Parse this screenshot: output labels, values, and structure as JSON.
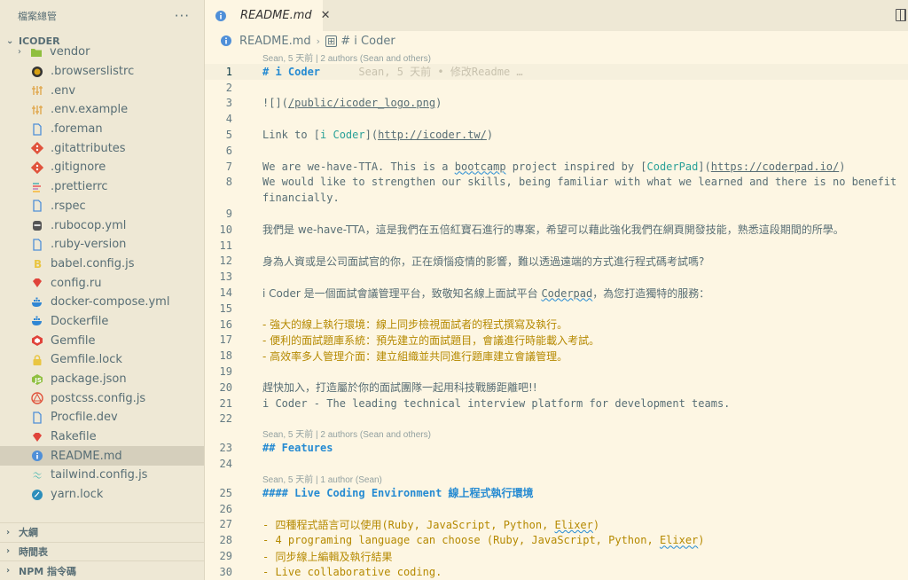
{
  "sidebar": {
    "title": "檔案總管",
    "more": "···",
    "project": "ICODER",
    "files": [
      {
        "name": "vendor",
        "icon": "folder-icon",
        "color": "#8fbf3f",
        "folder": true
      },
      {
        "name": ".browserslistrc",
        "icon": "browserslist-icon",
        "color": "#d6a013"
      },
      {
        "name": ".env",
        "icon": "env-icon",
        "color": "#e0a84e"
      },
      {
        "name": ".env.example",
        "icon": "env-icon",
        "color": "#e0a84e"
      },
      {
        "name": ".foreman",
        "icon": "file-icon",
        "color": "#4f8fd8"
      },
      {
        "name": ".gitattributes",
        "icon": "git-icon",
        "color": "#e0533c"
      },
      {
        "name": ".gitignore",
        "icon": "git-icon",
        "color": "#e0533c"
      },
      {
        "name": ".prettierrc",
        "icon": "prettier-icon",
        "color": "#c69bd6"
      },
      {
        "name": ".rspec",
        "icon": "file-icon",
        "color": "#4f8fd8"
      },
      {
        "name": ".rubocop.yml",
        "icon": "rubocop-icon",
        "color": "#555555"
      },
      {
        "name": ".ruby-version",
        "icon": "file-icon",
        "color": "#4f8fd8"
      },
      {
        "name": "babel.config.js",
        "icon": "babel-icon",
        "color": "#e9c541"
      },
      {
        "name": "config.ru",
        "icon": "ruby-icon",
        "color": "#e0433a"
      },
      {
        "name": "docker-compose.yml",
        "icon": "docker-icon",
        "color": "#2f86d4"
      },
      {
        "name": "Dockerfile",
        "icon": "docker-icon",
        "color": "#2f86d4"
      },
      {
        "name": "Gemfile",
        "icon": "gem-icon",
        "color": "#e0433a"
      },
      {
        "name": "Gemfile.lock",
        "icon": "lock-icon",
        "color": "#e9c541"
      },
      {
        "name": "package.json",
        "icon": "npm-icon",
        "color": "#8fbf3f"
      },
      {
        "name": "postcss.config.js",
        "icon": "postcss-icon",
        "color": "#e0533c"
      },
      {
        "name": "Procfile.dev",
        "icon": "file-icon",
        "color": "#4f8fd8"
      },
      {
        "name": "Rakefile",
        "icon": "ruby-icon",
        "color": "#e0433a"
      },
      {
        "name": "README.md",
        "icon": "info-icon",
        "color": "#4f8fd8",
        "active": true
      },
      {
        "name": "tailwind.config.js",
        "icon": "tailwind-icon",
        "color": "#38b2ac"
      },
      {
        "name": "yarn.lock",
        "icon": "yarn-icon",
        "color": "#2c8ebb"
      }
    ],
    "panels": [
      "大綱",
      "時間表",
      "NPM 指令碼"
    ]
  },
  "tab": {
    "title": "README.md",
    "close": "✕"
  },
  "breadcrumb": {
    "file": "README.md",
    "sep": "›",
    "section": "# i Coder"
  },
  "editor": {
    "lines": [
      {
        "type": "lens",
        "text": "Sean, 5 天前 | 2 authors (Sean and others)"
      },
      {
        "n": "1",
        "segs": [
          {
            "c": "hdr",
            "t": "# i Coder"
          },
          {
            "c": "blame",
            "t": "      Sean, 5 天前 • 修改Readme …"
          }
        ],
        "current": true
      },
      {
        "n": "2",
        "segs": []
      },
      {
        "n": "3",
        "segs": [
          {
            "c": "",
            "t": "![]("
          },
          {
            "c": "url",
            "t": "/public/icoder_logo.png"
          },
          {
            "c": "",
            "t": ")"
          }
        ]
      },
      {
        "n": "4",
        "segs": []
      },
      {
        "n": "5",
        "segs": [
          {
            "c": "",
            "t": "Link to ["
          },
          {
            "c": "lnk",
            "t": "i Coder"
          },
          {
            "c": "",
            "t": "]("
          },
          {
            "c": "url",
            "t": "http://icoder.tw/"
          },
          {
            "c": "",
            "t": ")"
          }
        ]
      },
      {
        "n": "6",
        "segs": []
      },
      {
        "n": "7",
        "segs": [
          {
            "c": "",
            "t": "We are we-have-TTA. This is a "
          },
          {
            "c": "squig",
            "t": "bootcamp"
          },
          {
            "c": "",
            "t": " project inspired by ["
          },
          {
            "c": "lnk",
            "t": "CoderPad"
          },
          {
            "c": "",
            "t": "]("
          },
          {
            "c": "url",
            "t": "https://coderpad.io/"
          },
          {
            "c": "",
            "t": ")"
          }
        ]
      },
      {
        "n": "8",
        "segs": [
          {
            "c": "",
            "t": "We would like to strengthen our skills, being familiar with what we learned and there is no benefit"
          }
        ]
      },
      {
        "n": "",
        "segs": [
          {
            "c": "",
            "t": "financially."
          }
        ]
      },
      {
        "n": "9",
        "segs": []
      },
      {
        "n": "10",
        "segs": [
          {
            "c": "cjk",
            "t": "我們是 we-have-TTA，這是我們在五倍紅寶石進行的專案，希望可以藉此強化我們在網頁開發技能，熟悉這段期間的所學。"
          }
        ]
      },
      {
        "n": "11",
        "segs": []
      },
      {
        "n": "12",
        "segs": [
          {
            "c": "cjk",
            "t": "身為人資或是公司面試官的你，正在煩惱疫情的影響，難以透過遠端的方式進行程式碼考試嗎?"
          }
        ]
      },
      {
        "n": "13",
        "segs": []
      },
      {
        "n": "14",
        "segs": [
          {
            "c": "cjk",
            "t": "i Coder 是一個面試會議管理平台，致敬知名線上面試平台 "
          },
          {
            "c": "squig",
            "t": "Coderpad"
          },
          {
            "c": "cjk",
            "t": "，為您打造獨特的服務："
          }
        ]
      },
      {
        "n": "15",
        "segs": []
      },
      {
        "n": "16",
        "segs": [
          {
            "c": "list cjk",
            "t": "- 強大的線上執行環境：線上同步檢視面試者的程式撰寫及執行。"
          }
        ]
      },
      {
        "n": "17",
        "segs": [
          {
            "c": "list cjk",
            "t": "- 便利的面試題庫系統：預先建立的面試題目，會議進行時能載入考試。"
          }
        ]
      },
      {
        "n": "18",
        "segs": [
          {
            "c": "list cjk",
            "t": "- 高效率多人管理介面：建立組織並共同進行題庫建立會議管理。"
          }
        ]
      },
      {
        "n": "19",
        "segs": []
      },
      {
        "n": "20",
        "segs": [
          {
            "c": "cjk",
            "t": "趕快加入，打造屬於你的面試團隊一起用科技戰勝距離吧!!"
          }
        ]
      },
      {
        "n": "21",
        "segs": [
          {
            "c": "",
            "t": "i Coder - The leading technical interview platform for development teams."
          }
        ]
      },
      {
        "n": "22",
        "segs": []
      },
      {
        "type": "lens",
        "text": "Sean, 5 天前 | 2 authors (Sean and others)"
      },
      {
        "n": "23",
        "segs": [
          {
            "c": "hdr",
            "t": "## Features"
          }
        ]
      },
      {
        "n": "24",
        "segs": []
      },
      {
        "type": "lens",
        "text": "Sean, 5 天前 | 1 author (Sean)"
      },
      {
        "n": "25",
        "segs": [
          {
            "c": "hdr",
            "t": "#### Live Coding Environment 線上程式執行環境"
          }
        ]
      },
      {
        "n": "26",
        "segs": []
      },
      {
        "n": "27",
        "segs": [
          {
            "c": "list",
            "t": "- 四種程式語言可以使用(Ruby, JavaScript, Python, "
          },
          {
            "c": "list squig",
            "t": "Elixer"
          },
          {
            "c": "list",
            "t": ")"
          }
        ]
      },
      {
        "n": "28",
        "segs": [
          {
            "c": "list",
            "t": "- 4 programing language can choose (Ruby, JavaScript, Python, "
          },
          {
            "c": "list squig",
            "t": "Elixer"
          },
          {
            "c": "list",
            "t": ")"
          }
        ]
      },
      {
        "n": "29",
        "segs": [
          {
            "c": "list",
            "t": "- 同步線上編輯及執行結果"
          }
        ]
      },
      {
        "n": "30",
        "segs": [
          {
            "c": "list",
            "t": "- Live collaborative coding."
          }
        ]
      }
    ]
  }
}
